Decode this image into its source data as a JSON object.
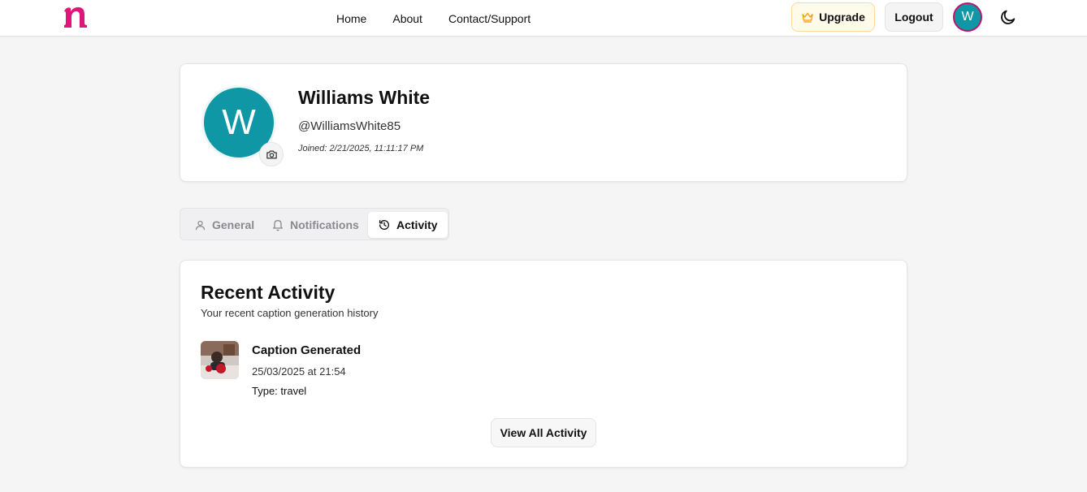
{
  "header": {
    "logo_letter": "n",
    "nav": [
      "Home",
      "About",
      "Contact/Support"
    ],
    "upgrade_label": "Upgrade",
    "logout_label": "Logout",
    "avatar_initial": "W"
  },
  "profile": {
    "avatar_initial": "W",
    "name": "Williams White",
    "username": "@WilliamsWhite85",
    "joined": "Joined: 2/21/2025, 11:11:17 PM"
  },
  "tabs": [
    {
      "label": "General",
      "icon": "user-icon",
      "active": false
    },
    {
      "label": "Notifications",
      "icon": "bell-icon",
      "active": false
    },
    {
      "label": "Activity",
      "icon": "history-icon",
      "active": true
    }
  ],
  "activity": {
    "title": "Recent Activity",
    "subtitle": "Your recent caption generation history",
    "items": [
      {
        "title": "Caption Generated",
        "date": "25/03/2025 at 21:54",
        "type": "Type: travel"
      }
    ],
    "view_all_label": "View All Activity"
  },
  "colors": {
    "brand": "#e0157a",
    "avatar_bg": "#0f97a6",
    "upgrade_bg": "#fffbeb",
    "crown": "#f59e0b"
  }
}
